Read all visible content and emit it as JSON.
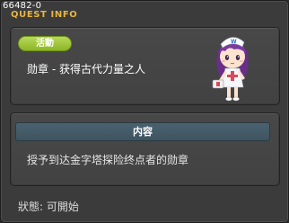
{
  "window": {
    "id_label": "66482-0",
    "title": "QUEST INFO"
  },
  "quest": {
    "category_badge": "活動",
    "name": "勋章 - 获得古代力量之人",
    "npc_icon": "nurse-girl-npc-icon"
  },
  "content": {
    "header": "内容",
    "text": "授予到达金字塔探险终点者的勋章"
  },
  "status": {
    "text": "狀態: 可開始"
  },
  "colors": {
    "title": "#e8b53c",
    "badge": "#9cc33a",
    "section_header": "#445a66",
    "window_bg": "#3b3b3b"
  }
}
